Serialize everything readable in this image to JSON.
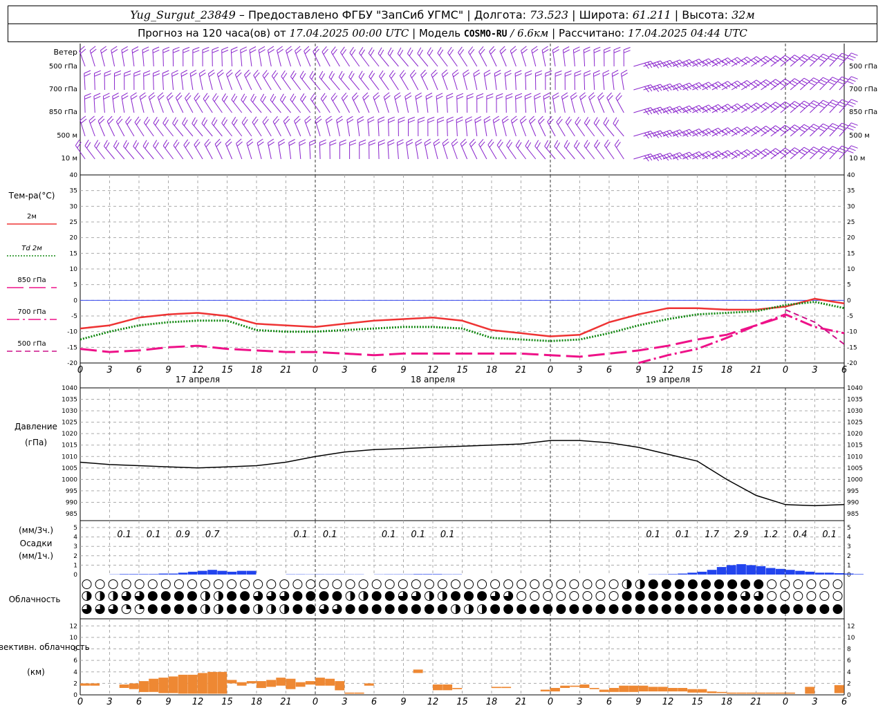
{
  "header": {
    "station": "Yug_Surgut_23849",
    "provider": "– Предоставлено ФГБУ \"ЗапСиб УГМС\"",
    "lon_label": "Долгота:",
    "lon": "73.523",
    "lat_label": "Широта:",
    "lat": "61.211",
    "alt_label": "Высота:",
    "alt": "32м",
    "forecast_prefix": "Прогноз на 120 часа(ов) от",
    "forecast_time": "17.04.2025 00:00 UTC",
    "model_label": "Модель",
    "model": "COSMO-RU",
    "model_res": "/ 6.6км",
    "calc_label": "Рассчитано:",
    "calc_time": "17.04.2025 04:44 UTC"
  },
  "colors": {
    "t2m": "#ee3333",
    "td2m": "#118811",
    "t850": "#ee1188",
    "t700": "#ee1188",
    "t500": "#cc1188",
    "wind": "#8822cc",
    "precip": "#2244ee",
    "conv": "#ee8833",
    "zero_line": "#3344ee"
  },
  "time_axis": {
    "hour_labels": [
      "0",
      "3",
      "6",
      "9",
      "12",
      "15",
      "18",
      "21",
      "0",
      "3",
      "6",
      "9",
      "12",
      "15",
      "18",
      "21",
      "0",
      "3",
      "6",
      "9",
      "12",
      "15",
      "18",
      "21",
      "0",
      "3",
      "6"
    ],
    "date_labels": [
      "17 апреля",
      "18 апреля",
      "19 апреля"
    ]
  },
  "wind_panel": {
    "title": "Ветер",
    "levels": [
      "500 гПа",
      "700 гПа",
      "850 гПа",
      "500 м",
      "10  м"
    ]
  },
  "chart_data": [
    {
      "type": "line",
      "title": "Тем-ра(°C)",
      "ylim": [
        -20,
        40
      ],
      "yticks": [
        "40",
        "35",
        "30",
        "25",
        "20",
        "15",
        "10",
        "5",
        "0",
        "-5",
        "-10",
        "-15",
        "-20"
      ],
      "x_hours": [
        0,
        3,
        6,
        9,
        12,
        15,
        18,
        21,
        24,
        27,
        30,
        33,
        36,
        39,
        42,
        45,
        48,
        51,
        54,
        57,
        60,
        63,
        66,
        69,
        72,
        75,
        78
      ],
      "series": [
        {
          "name": "2м",
          "style": "solid",
          "values": [
            -9,
            -8,
            -5.5,
            -4.5,
            -4,
            -5,
            -7.5,
            -8,
            -8.5,
            -7.5,
            -6.5,
            -6,
            -5.5,
            -6.5,
            -9.5,
            -10.5,
            -11.5,
            -11,
            -7,
            -4.5,
            -2.5,
            -2.5,
            -3,
            -3,
            -2,
            0.5,
            -1
          ]
        },
        {
          "name": "Td  2м",
          "style": "dotted",
          "values": [
            -12.5,
            -10,
            -8,
            -7,
            -6.5,
            -6.5,
            -9.5,
            -10,
            -10,
            -9.5,
            -9,
            -8.5,
            -8.5,
            -9,
            -12,
            -12.5,
            -13,
            -12.5,
            -10.5,
            -8,
            -6,
            -4.5,
            -4,
            -3.5,
            -1.5,
            -0.5,
            -2.5
          ]
        },
        {
          "name": "850 гПа",
          "style": "longdash",
          "values": [
            -15.5,
            -16.5,
            -16,
            -15,
            -14.5,
            -15.5,
            -16,
            -16.5,
            -16.5,
            -17,
            -17.5,
            -17,
            -17,
            -17,
            -17,
            -17,
            -17.5,
            -18,
            -17,
            -16,
            -14.5,
            -12.5,
            -11,
            -8,
            -5,
            null,
            null
          ]
        },
        {
          "name": "700 гПа",
          "style": "dashdot",
          "values": [
            null,
            null,
            null,
            null,
            null,
            null,
            null,
            null,
            null,
            null,
            null,
            null,
            null,
            null,
            null,
            null,
            null,
            null,
            null,
            -20,
            -17.5,
            -15.5,
            -12,
            -8,
            -4.5,
            -8.5,
            -10.5
          ]
        },
        {
          "name": "500 гПа",
          "style": "dashed",
          "values": [
            null,
            null,
            null,
            null,
            null,
            null,
            null,
            null,
            null,
            null,
            null,
            null,
            null,
            null,
            null,
            null,
            null,
            null,
            null,
            null,
            null,
            null,
            null,
            null,
            -3,
            -7,
            -14
          ]
        }
      ]
    },
    {
      "type": "line",
      "title": "Давление",
      "ylabel": "(гПа)",
      "ylim": [
        985,
        1040
      ],
      "yticks": [
        "1040",
        "1035",
        "1030",
        "1025",
        "1020",
        "1015",
        "1010",
        "1005",
        "1000",
        "995",
        "990",
        "985"
      ],
      "x_hours": [
        0,
        3,
        6,
        9,
        12,
        15,
        18,
        21,
        24,
        27,
        30,
        33,
        36,
        39,
        42,
        45,
        48,
        51,
        54,
        57,
        60,
        63,
        66,
        69,
        72,
        75,
        78
      ],
      "series": [
        {
          "name": "Давление",
          "values": [
            1007.5,
            1006.5,
            1006,
            1005.5,
            1005,
            1005.5,
            1006,
            1007.5,
            1010,
            1012,
            1013,
            1013.5,
            1014,
            1014.5,
            1015,
            1015.5,
            1017,
            1017,
            1016,
            1014,
            1011,
            1008,
            1000,
            993,
            989,
            988.5,
            989
          ]
        }
      ]
    },
    {
      "type": "bar",
      "title": "Осадки",
      "ylabel_top": "(мм/3ч.)",
      "ylabel_bottom": "(мм/1ч.)",
      "ylim": [
        0,
        5
      ],
      "yticks": [
        "5",
        "4",
        "3",
        "2",
        "1",
        "0"
      ],
      "labels_3h": [
        {
          "hour": 4.5,
          "value": "0.1"
        },
        {
          "hour": 7.5,
          "value": "0.1"
        },
        {
          "hour": 10.5,
          "value": "0.9"
        },
        {
          "hour": 13.5,
          "value": "0.7"
        },
        {
          "hour": 22.5,
          "value": "0.1"
        },
        {
          "hour": 25.5,
          "value": "0.1"
        },
        {
          "hour": 31.5,
          "value": "0.1"
        },
        {
          "hour": 34.5,
          "value": "0.1"
        },
        {
          "hour": 37.5,
          "value": "0.1"
        },
        {
          "hour": 58.5,
          "value": "0.1"
        },
        {
          "hour": 61.5,
          "value": "0.1"
        },
        {
          "hour": 64.5,
          "value": "1.7"
        },
        {
          "hour": 67.5,
          "value": "2.9"
        },
        {
          "hour": 70.5,
          "value": "1.2"
        },
        {
          "hour": 73.5,
          "value": "0.4"
        },
        {
          "hour": 76.5,
          "value": "0.1"
        }
      ],
      "hourly_mm": [
        0,
        0,
        0,
        0.02,
        0.05,
        0.05,
        0.05,
        0.05,
        0.1,
        0.1,
        0.2,
        0.3,
        0.4,
        0.5,
        0.4,
        0.3,
        0.4,
        0.4,
        0,
        0,
        0,
        0.03,
        0.03,
        0.02,
        0.03,
        0.03,
        0.03,
        0.02,
        0.02,
        0,
        0.02,
        0.03,
        0.03,
        0.03,
        0.05,
        0.05,
        0.05,
        0.03,
        0.03,
        0,
        0,
        0,
        0,
        0,
        0,
        0,
        0,
        0,
        0,
        0,
        0,
        0,
        0,
        0,
        0,
        0,
        0,
        0,
        0.02,
        0.03,
        0.05,
        0.1,
        0.2,
        0.3,
        0.5,
        0.8,
        1,
        1.1,
        1,
        0.9,
        0.7,
        0.6,
        0.5,
        0.4,
        0.3,
        0.2,
        0.2,
        0.15,
        0.1,
        0.05
      ]
    },
    {
      "type": "table",
      "title": "Облачность",
      "rows": [
        "high",
        "middle",
        "low"
      ],
      "fractions_by_3h": {
        "high": [
          0,
          0,
          0,
          0,
          0,
          0,
          0,
          0,
          0,
          0,
          0,
          0,
          0,
          0,
          0,
          0,
          0,
          0,
          0,
          0.5,
          1,
          1,
          1,
          1,
          0,
          0,
          0
        ],
        "middle": [
          0.5,
          0.75,
          1,
          1,
          0.5,
          1,
          0.75,
          1,
          1,
          0.5,
          1,
          0.75,
          0.5,
          1,
          0.75,
          0,
          0,
          0,
          0,
          1,
          1,
          1,
          1,
          0.75,
          0,
          0,
          0
        ],
        "low": [
          0.75,
          0.25,
          1,
          1,
          0.5,
          1,
          0.5,
          1,
          0.75,
          1,
          1,
          1,
          1,
          0.5,
          1,
          1,
          1,
          1,
          1,
          1,
          1,
          1,
          1,
          1,
          1,
          1,
          1
        ]
      }
    },
    {
      "type": "bar",
      "title": "Конвективн. облачность",
      "ylabel": "(км)",
      "ylim": [
        0,
        13
      ],
      "yticks": [
        "12",
        "10",
        "8",
        "6",
        "4",
        "2",
        "0"
      ],
      "layers_km": [
        {
          "hour": 0.5,
          "base": 1.6,
          "top": 2.0
        },
        {
          "hour": 1.5,
          "base": 1.6,
          "top": 2.0
        },
        {
          "hour": 4.5,
          "base": 1.2,
          "top": 1.8
        },
        {
          "hour": 5.5,
          "base": 1.0,
          "top": 2.0
        },
        {
          "hour": 6.5,
          "base": 0.5,
          "top": 2.4
        },
        {
          "hour": 7.5,
          "base": 0.5,
          "top": 2.8
        },
        {
          "hour": 8.5,
          "base": 0.3,
          "top": 3.0
        },
        {
          "hour": 9.5,
          "base": 0.3,
          "top": 3.2
        },
        {
          "hour": 10.5,
          "base": 0.2,
          "top": 3.5
        },
        {
          "hour": 11.5,
          "base": 0.2,
          "top": 3.5
        },
        {
          "hour": 12.5,
          "base": 0.2,
          "top": 3.8
        },
        {
          "hour": 13.5,
          "base": 0.2,
          "top": 4.0
        },
        {
          "hour": 14.5,
          "base": 0.2,
          "top": 4.0
        },
        {
          "hour": 15.5,
          "base": 2.0,
          "top": 2.6
        },
        {
          "hour": 16.5,
          "base": 1.6,
          "top": 2.2
        },
        {
          "hour": 17.5,
          "base": 2.0,
          "top": 2.4
        },
        {
          "hour": 18.5,
          "base": 1.2,
          "top": 2.4
        },
        {
          "hour": 19.5,
          "base": 1.4,
          "top": 2.6
        },
        {
          "hour": 20.5,
          "base": 1.6,
          "top": 3.0
        },
        {
          "hour": 21.5,
          "base": 1.0,
          "top": 2.8
        },
        {
          "hour": 22.5,
          "base": 1.4,
          "top": 2.2
        },
        {
          "hour": 23.5,
          "base": 1.8,
          "top": 2.4
        },
        {
          "hour": 24.5,
          "base": 1.6,
          "top": 3.0
        },
        {
          "hour": 25.5,
          "base": 1.6,
          "top": 2.8
        },
        {
          "hour": 26.5,
          "base": 0.8,
          "top": 2.4
        },
        {
          "hour": 27.5,
          "base": 0.2,
          "top": 0.4
        },
        {
          "hour": 28.5,
          "base": 0.2,
          "top": 0.4
        },
        {
          "hour": 29.5,
          "base": 1.6,
          "top": 2.0
        },
        {
          "hour": 34.5,
          "base": 3.8,
          "top": 4.4
        },
        {
          "hour": 36.5,
          "base": 0.8,
          "top": 1.8
        },
        {
          "hour": 37.5,
          "base": 0.8,
          "top": 1.8
        },
        {
          "hour": 38.5,
          "base": 1.0,
          "top": 1.2
        },
        {
          "hour": 42.5,
          "base": 1.2,
          "top": 1.4
        },
        {
          "hour": 43.5,
          "base": 1.2,
          "top": 1.4
        },
        {
          "hour": 47.5,
          "base": 0.6,
          "top": 0.9
        },
        {
          "hour": 48.5,
          "base": 0.6,
          "top": 1.2
        },
        {
          "hour": 49.5,
          "base": 1.2,
          "top": 1.6
        },
        {
          "hour": 50.5,
          "base": 1.4,
          "top": 1.6
        },
        {
          "hour": 51.5,
          "base": 1.2,
          "top": 1.8
        },
        {
          "hour": 52.5,
          "base": 1.0,
          "top": 1.2
        },
        {
          "hour": 53.5,
          "base": 0.5,
          "top": 0.9
        },
        {
          "hour": 54.5,
          "base": 0.5,
          "top": 1.2
        },
        {
          "hour": 55.5,
          "base": 0.5,
          "top": 1.6
        },
        {
          "hour": 56.5,
          "base": 0.5,
          "top": 1.6
        },
        {
          "hour": 57.5,
          "base": 0.6,
          "top": 1.6
        },
        {
          "hour": 58.5,
          "base": 0.6,
          "top": 1.4
        },
        {
          "hour": 59.5,
          "base": 0.6,
          "top": 1.4
        },
        {
          "hour": 60.5,
          "base": 0.6,
          "top": 1.2
        },
        {
          "hour": 61.5,
          "base": 0.6,
          "top": 1.2
        },
        {
          "hour": 62.5,
          "base": 0.4,
          "top": 1.0
        },
        {
          "hour": 63.5,
          "base": 0.4,
          "top": 1.0
        },
        {
          "hour": 64.5,
          "base": 0.3,
          "top": 0.6
        },
        {
          "hour": 65.5,
          "base": 0.3,
          "top": 0.5
        },
        {
          "hour": 66.5,
          "base": 0.2,
          "top": 0.4
        },
        {
          "hour": 67.5,
          "base": 0.2,
          "top": 0.4
        },
        {
          "hour": 68.5,
          "base": 0.2,
          "top": 0.4
        },
        {
          "hour": 69.5,
          "base": 0.2,
          "top": 0.4
        },
        {
          "hour": 70.5,
          "base": 0.2,
          "top": 0.4
        },
        {
          "hour": 71.5,
          "base": 0.2,
          "top": 0.4
        },
        {
          "hour": 72.5,
          "base": 0.2,
          "top": 0.4
        },
        {
          "hour": 74.5,
          "base": 0.2,
          "top": 1.4
        },
        {
          "hour": 77.5,
          "base": 0.3,
          "top": 1.7
        }
      ]
    }
  ]
}
